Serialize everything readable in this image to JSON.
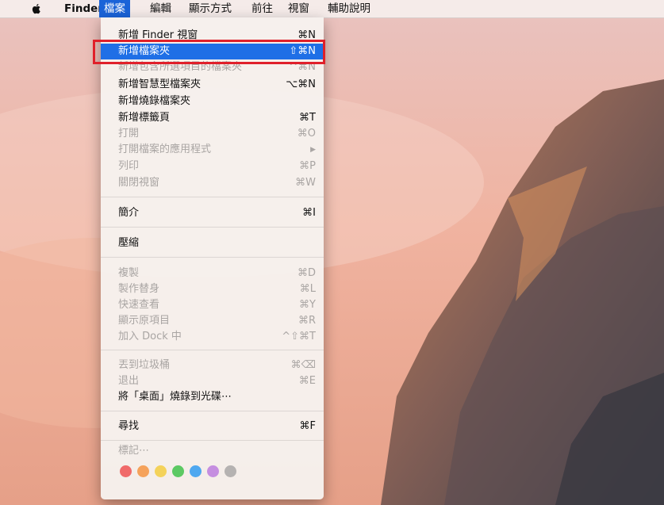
{
  "menubar": {
    "items": [
      {
        "label": "Finder"
      },
      {
        "label": "檔案"
      },
      {
        "label": "編輯"
      },
      {
        "label": "顯示方式"
      },
      {
        "label": "前往"
      },
      {
        "label": "視窗"
      },
      {
        "label": "輔助說明"
      }
    ]
  },
  "file_menu": {
    "items": [
      {
        "label": "新增 Finder 視窗",
        "shortcut": "⌘N"
      },
      {
        "label": "新增檔案夾",
        "shortcut": "⇧⌘N"
      },
      {
        "label": "新增包含所選項目的檔案夾",
        "shortcut": "^⌘N"
      },
      {
        "label": "新增智慧型檔案夾",
        "shortcut": "⌥⌘N"
      },
      {
        "label": "新增燒錄檔案夾",
        "shortcut": ""
      },
      {
        "label": "新增標籤頁",
        "shortcut": "⌘T"
      },
      {
        "label": "打開",
        "shortcut": "⌘O"
      },
      {
        "label": "打開檔案的應用程式",
        "shortcut": "▶"
      },
      {
        "label": "列印",
        "shortcut": "⌘P"
      },
      {
        "label": "關閉視窗",
        "shortcut": "⌘W"
      },
      {
        "label": "簡介",
        "shortcut": "⌘I"
      },
      {
        "label": "壓縮",
        "shortcut": ""
      },
      {
        "label": "複製",
        "shortcut": "⌘D"
      },
      {
        "label": "製作替身",
        "shortcut": "⌘L"
      },
      {
        "label": "快速查看",
        "shortcut": "⌘Y"
      },
      {
        "label": "顯示原項目",
        "shortcut": "⌘R"
      },
      {
        "label": "加入 Dock 中",
        "shortcut": "^⇧⌘T"
      },
      {
        "label": "丟到垃圾桶",
        "shortcut": "⌘⌫"
      },
      {
        "label": "退出",
        "shortcut": "⌘E"
      },
      {
        "label": "將「桌面」燒錄到光碟⋯",
        "shortcut": ""
      },
      {
        "label": "尋找",
        "shortcut": "⌘F"
      },
      {
        "label": "標記⋯",
        "shortcut": ""
      }
    ],
    "tag_colors": [
      "#f06a6a",
      "#f5a25b",
      "#f4d25a",
      "#5cc963",
      "#4fa8f0",
      "#c58ee0",
      "#b5b2b1"
    ]
  }
}
